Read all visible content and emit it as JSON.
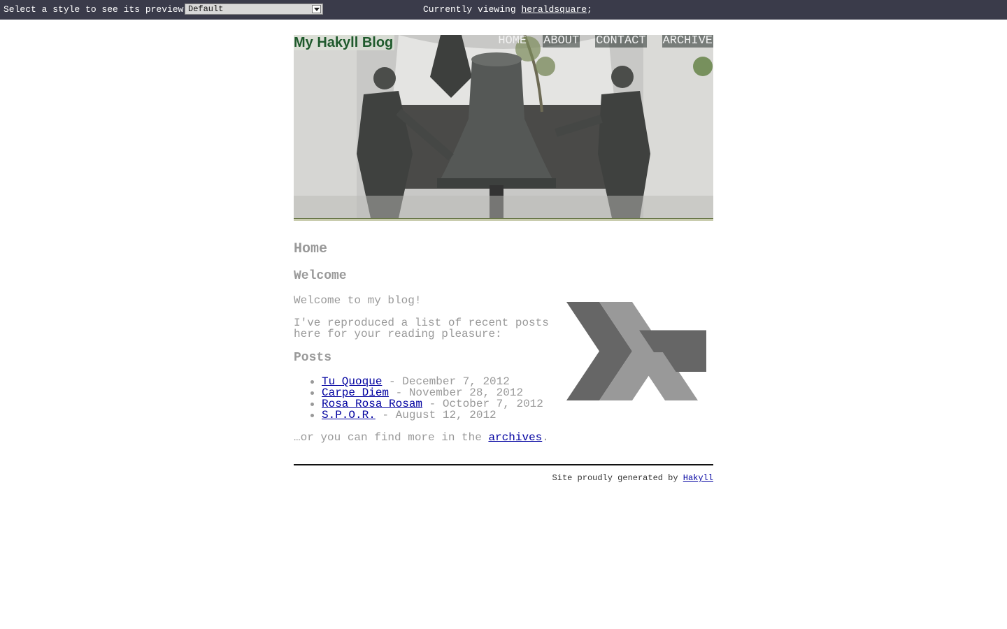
{
  "style_bar": {
    "label": "Select a style to see its preview:",
    "selected_style": "Default",
    "viewing_prefix": "Currently viewing ",
    "viewing_name": "heraldsquare",
    "viewing_suffix": ";"
  },
  "header": {
    "blog_title": "My Hakyll Blog",
    "nav": [
      "HOME",
      "ABOUT",
      "CONTACT",
      "ARCHIVE"
    ]
  },
  "main": {
    "page_heading": "Home",
    "welcome_heading": "Welcome",
    "welcome_text": "Welcome to my blog!",
    "intro_text": "I've reproduced a list of recent posts here for your reading pleasure:",
    "posts_heading": "Posts",
    "posts": [
      {
        "title": "Tu Quoque",
        "date": "December 7, 2012"
      },
      {
        "title": "Carpe Diem",
        "date": "November 28, 2012"
      },
      {
        "title": "Rosa Rosa Rosam",
        "date": "October 7, 2012"
      },
      {
        "title": "S.P.O.R.",
        "date": "August 12, 2012"
      }
    ],
    "more_prefix": "…or you can find more in the ",
    "more_link": "archives",
    "more_suffix": "."
  },
  "footer": {
    "text": "Site proudly generated by ",
    "link": "Hakyll"
  },
  "colors": {
    "top_bar": "#3a3b4a",
    "text": "#999999",
    "link": "#0000a0",
    "title_green": "#1f5a2c"
  }
}
